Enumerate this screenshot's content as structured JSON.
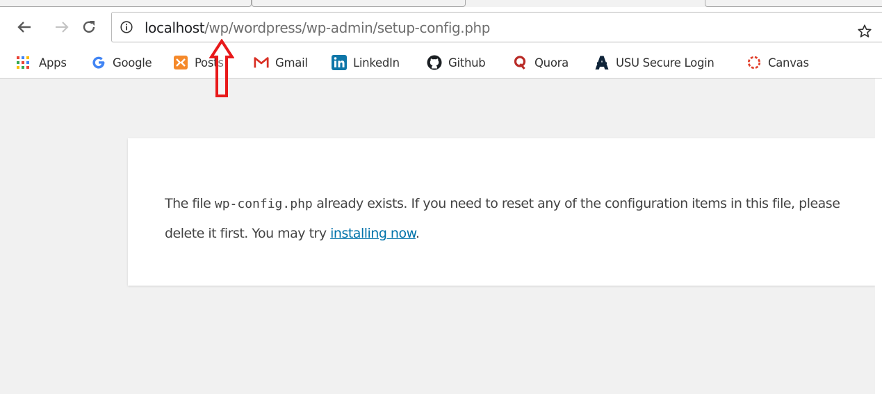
{
  "browser": {
    "url_host": "localhost",
    "url_path": "/wp/wordpress/wp-admin/setup-config.php"
  },
  "bookmarks": [
    {
      "label": "Apps",
      "icon": "apps-grid-icon"
    },
    {
      "label": "Google",
      "icon": "google-icon"
    },
    {
      "label": "Posts",
      "icon": "xampp-icon"
    },
    {
      "label": "Gmail",
      "icon": "gmail-icon"
    },
    {
      "label": "LinkedIn",
      "icon": "linkedin-icon"
    },
    {
      "label": "Github",
      "icon": "github-icon"
    },
    {
      "label": "Quora",
      "icon": "quora-icon"
    },
    {
      "label": "USU Secure Login",
      "icon": "usu-icon"
    },
    {
      "label": "Canvas",
      "icon": "canvas-icon"
    }
  ],
  "page": {
    "line1_prefix": "The file ",
    "filename": "wp-config.php",
    "line1_suffix": " already exists. If you need to reset any of the configuration items in this file, please",
    "line2_prefix": "delete it first. You may try ",
    "link_text": "installing now",
    "line2_suffix": "."
  },
  "colors": {
    "link": "#0073aa",
    "annotation_arrow": "#e8191a",
    "page_background": "#f1f1f1"
  }
}
